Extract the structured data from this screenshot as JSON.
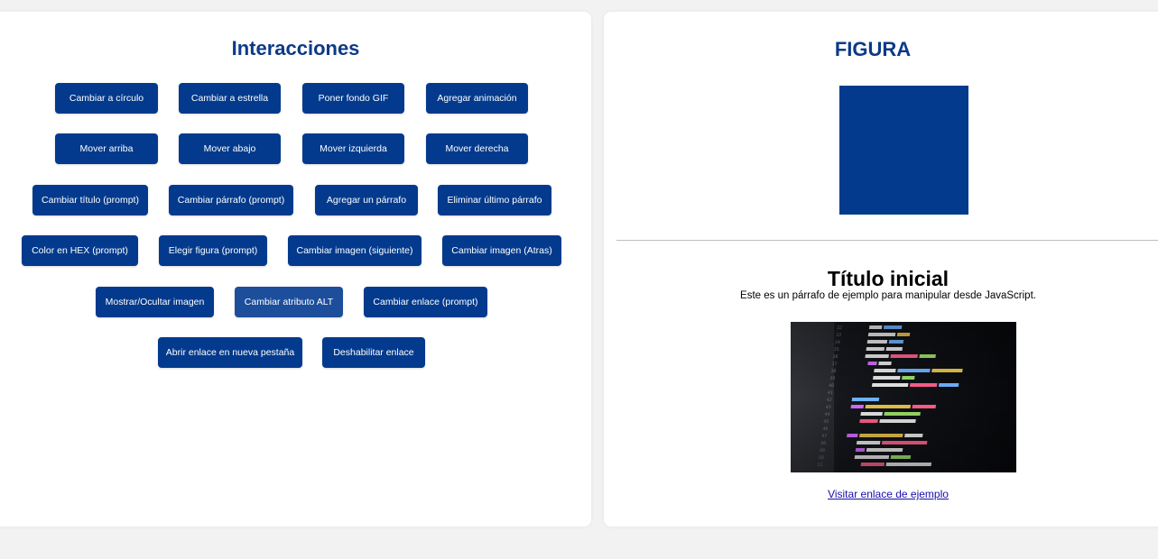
{
  "left": {
    "title": "Interacciones",
    "buttons": [
      "Cambiar a círculo",
      "Cambiar a estrella",
      "Poner fondo GIF",
      "Agregar animación",
      "Mover arriba",
      "Mover abajo",
      "Mover izquierda",
      "Mover derecha",
      "Cambiar título (prompt)",
      "Cambiar párrafo (prompt)",
      "Agregar un párrafo",
      "Eliminar último párrafo",
      "Color en HEX (prompt)",
      "Elegir figura (prompt)",
      "Cambiar imagen (siguiente)",
      "Cambiar imagen (Atras)",
      "Mostrar/Ocultar imagen",
      "Cambiar atributo ALT",
      "Cambiar enlace (prompt)",
      "Abrir enlace en nueva pestaña",
      "Deshabilitar enlace"
    ]
  },
  "right": {
    "title": "FIGURA",
    "doc_title": "Título inicial",
    "doc_paragraph": "Este es un párrafo de ejemplo para manipular desde JavaScript.",
    "link_text": "Visitar enlace de ejemplo",
    "figure_color": "#033a8d"
  },
  "colors": {
    "accent": "#033a8d",
    "title": "#0c3a88",
    "background": "#f2f2f2"
  }
}
